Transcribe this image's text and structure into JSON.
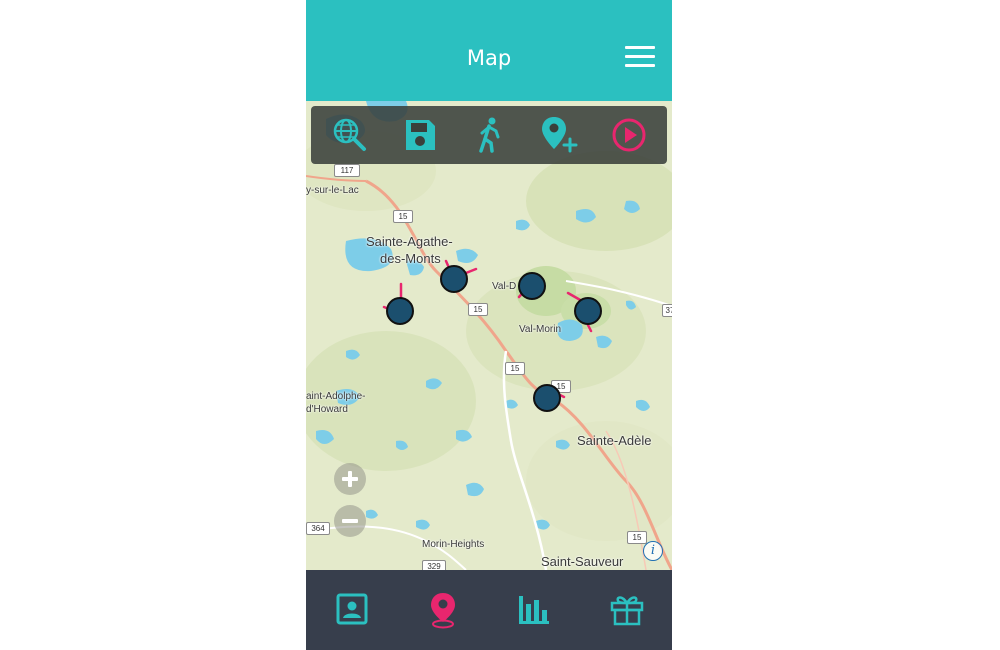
{
  "header": {
    "title": "Map",
    "menu_icon": "hamburger-menu-icon"
  },
  "toolbar": {
    "items": [
      {
        "icon": "globe-search-icon",
        "color": "#2bc0c0"
      },
      {
        "icon": "save-floppy-icon",
        "color": "#2bc0c0"
      },
      {
        "icon": "walking-person-icon",
        "color": "#2bc0c0"
      },
      {
        "icon": "add-location-pin-icon",
        "color": "#2bc0c0"
      },
      {
        "icon": "play-circle-icon",
        "color": "#e8266e"
      }
    ]
  },
  "map": {
    "places": {
      "sainte_agathe_1": "Sainte-Agathe-",
      "sainte_agathe_2": "des-Monts",
      "val_david": "Val-D",
      "val_morin": "Val-Morin",
      "sainte_adele": "Sainte-Adèle",
      "saint_adolphe_1": "aint-Adolphe-",
      "saint_adolphe_2": "d'Howard",
      "morin_heights": "Morin-Heights",
      "saint_sauveur": "Saint-Sauveur",
      "lac": "y-sur-le-Lac"
    },
    "routes": {
      "r117": "117",
      "r15a": "15",
      "r15b": "15",
      "r15c": "15",
      "r15d": "15",
      "r15e": "15",
      "r364": "364",
      "r329": "329",
      "r37": "37"
    },
    "zoom_in_icon": "plus-icon",
    "zoom_out_icon": "minus-icon",
    "info_label": "i",
    "marker_color": "#1b4f6e",
    "track_color": "#e8266e"
  },
  "bottom_nav": {
    "items": [
      {
        "icon": "profile-portrait-icon",
        "active": false
      },
      {
        "icon": "map-pin-icon",
        "active": true
      },
      {
        "icon": "bar-chart-icon",
        "active": false
      },
      {
        "icon": "gift-icon",
        "active": false
      }
    ],
    "active_color": "#e8266e",
    "inactive_color": "#2bc0c0"
  }
}
